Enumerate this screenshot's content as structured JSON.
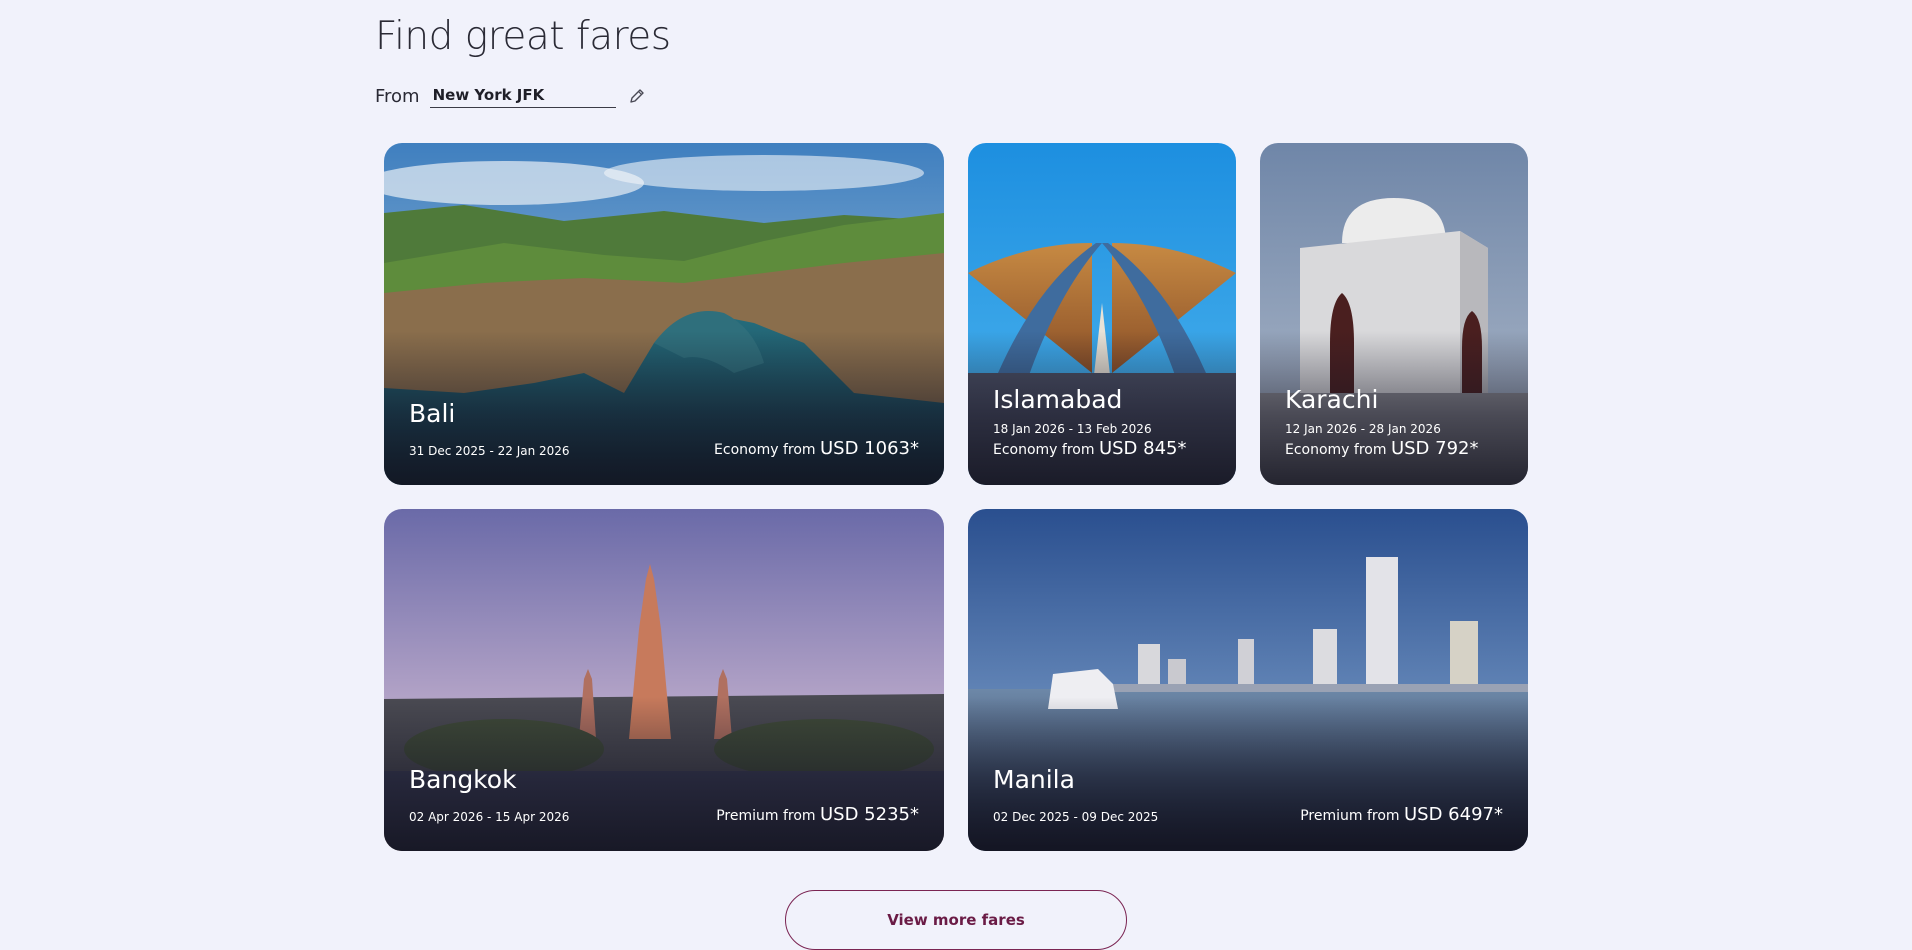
{
  "heading": "Find great fares",
  "from": {
    "label": "From",
    "value": "New York JFK"
  },
  "cards": [
    {
      "city": "Bali",
      "dates": "31 Dec 2025 - 22 Jan 2026",
      "cabin": "Economy from",
      "amount": "USD 1063*"
    },
    {
      "city": "Islamabad",
      "dates": "18 Jan 2026 - 13 Feb 2026",
      "cabin": "Economy from",
      "amount": "USD 845*"
    },
    {
      "city": "Karachi",
      "dates": "12 Jan 2026 - 28 Jan 2026",
      "cabin": "Economy from",
      "amount": "USD 792*"
    },
    {
      "city": "Bangkok",
      "dates": "02 Apr 2026 - 15 Apr 2026",
      "cabin": "Premium from",
      "amount": "USD 5235*"
    },
    {
      "city": "Manila",
      "dates": "02 Dec 2025 - 09 Dec 2025",
      "cabin": "Premium from",
      "amount": "USD 6497*"
    }
  ],
  "more_button": "View more fares",
  "icons": {
    "edit": "pencil-icon"
  },
  "colors": {
    "accent": "#7a2452",
    "background": "#f1f2fb"
  }
}
